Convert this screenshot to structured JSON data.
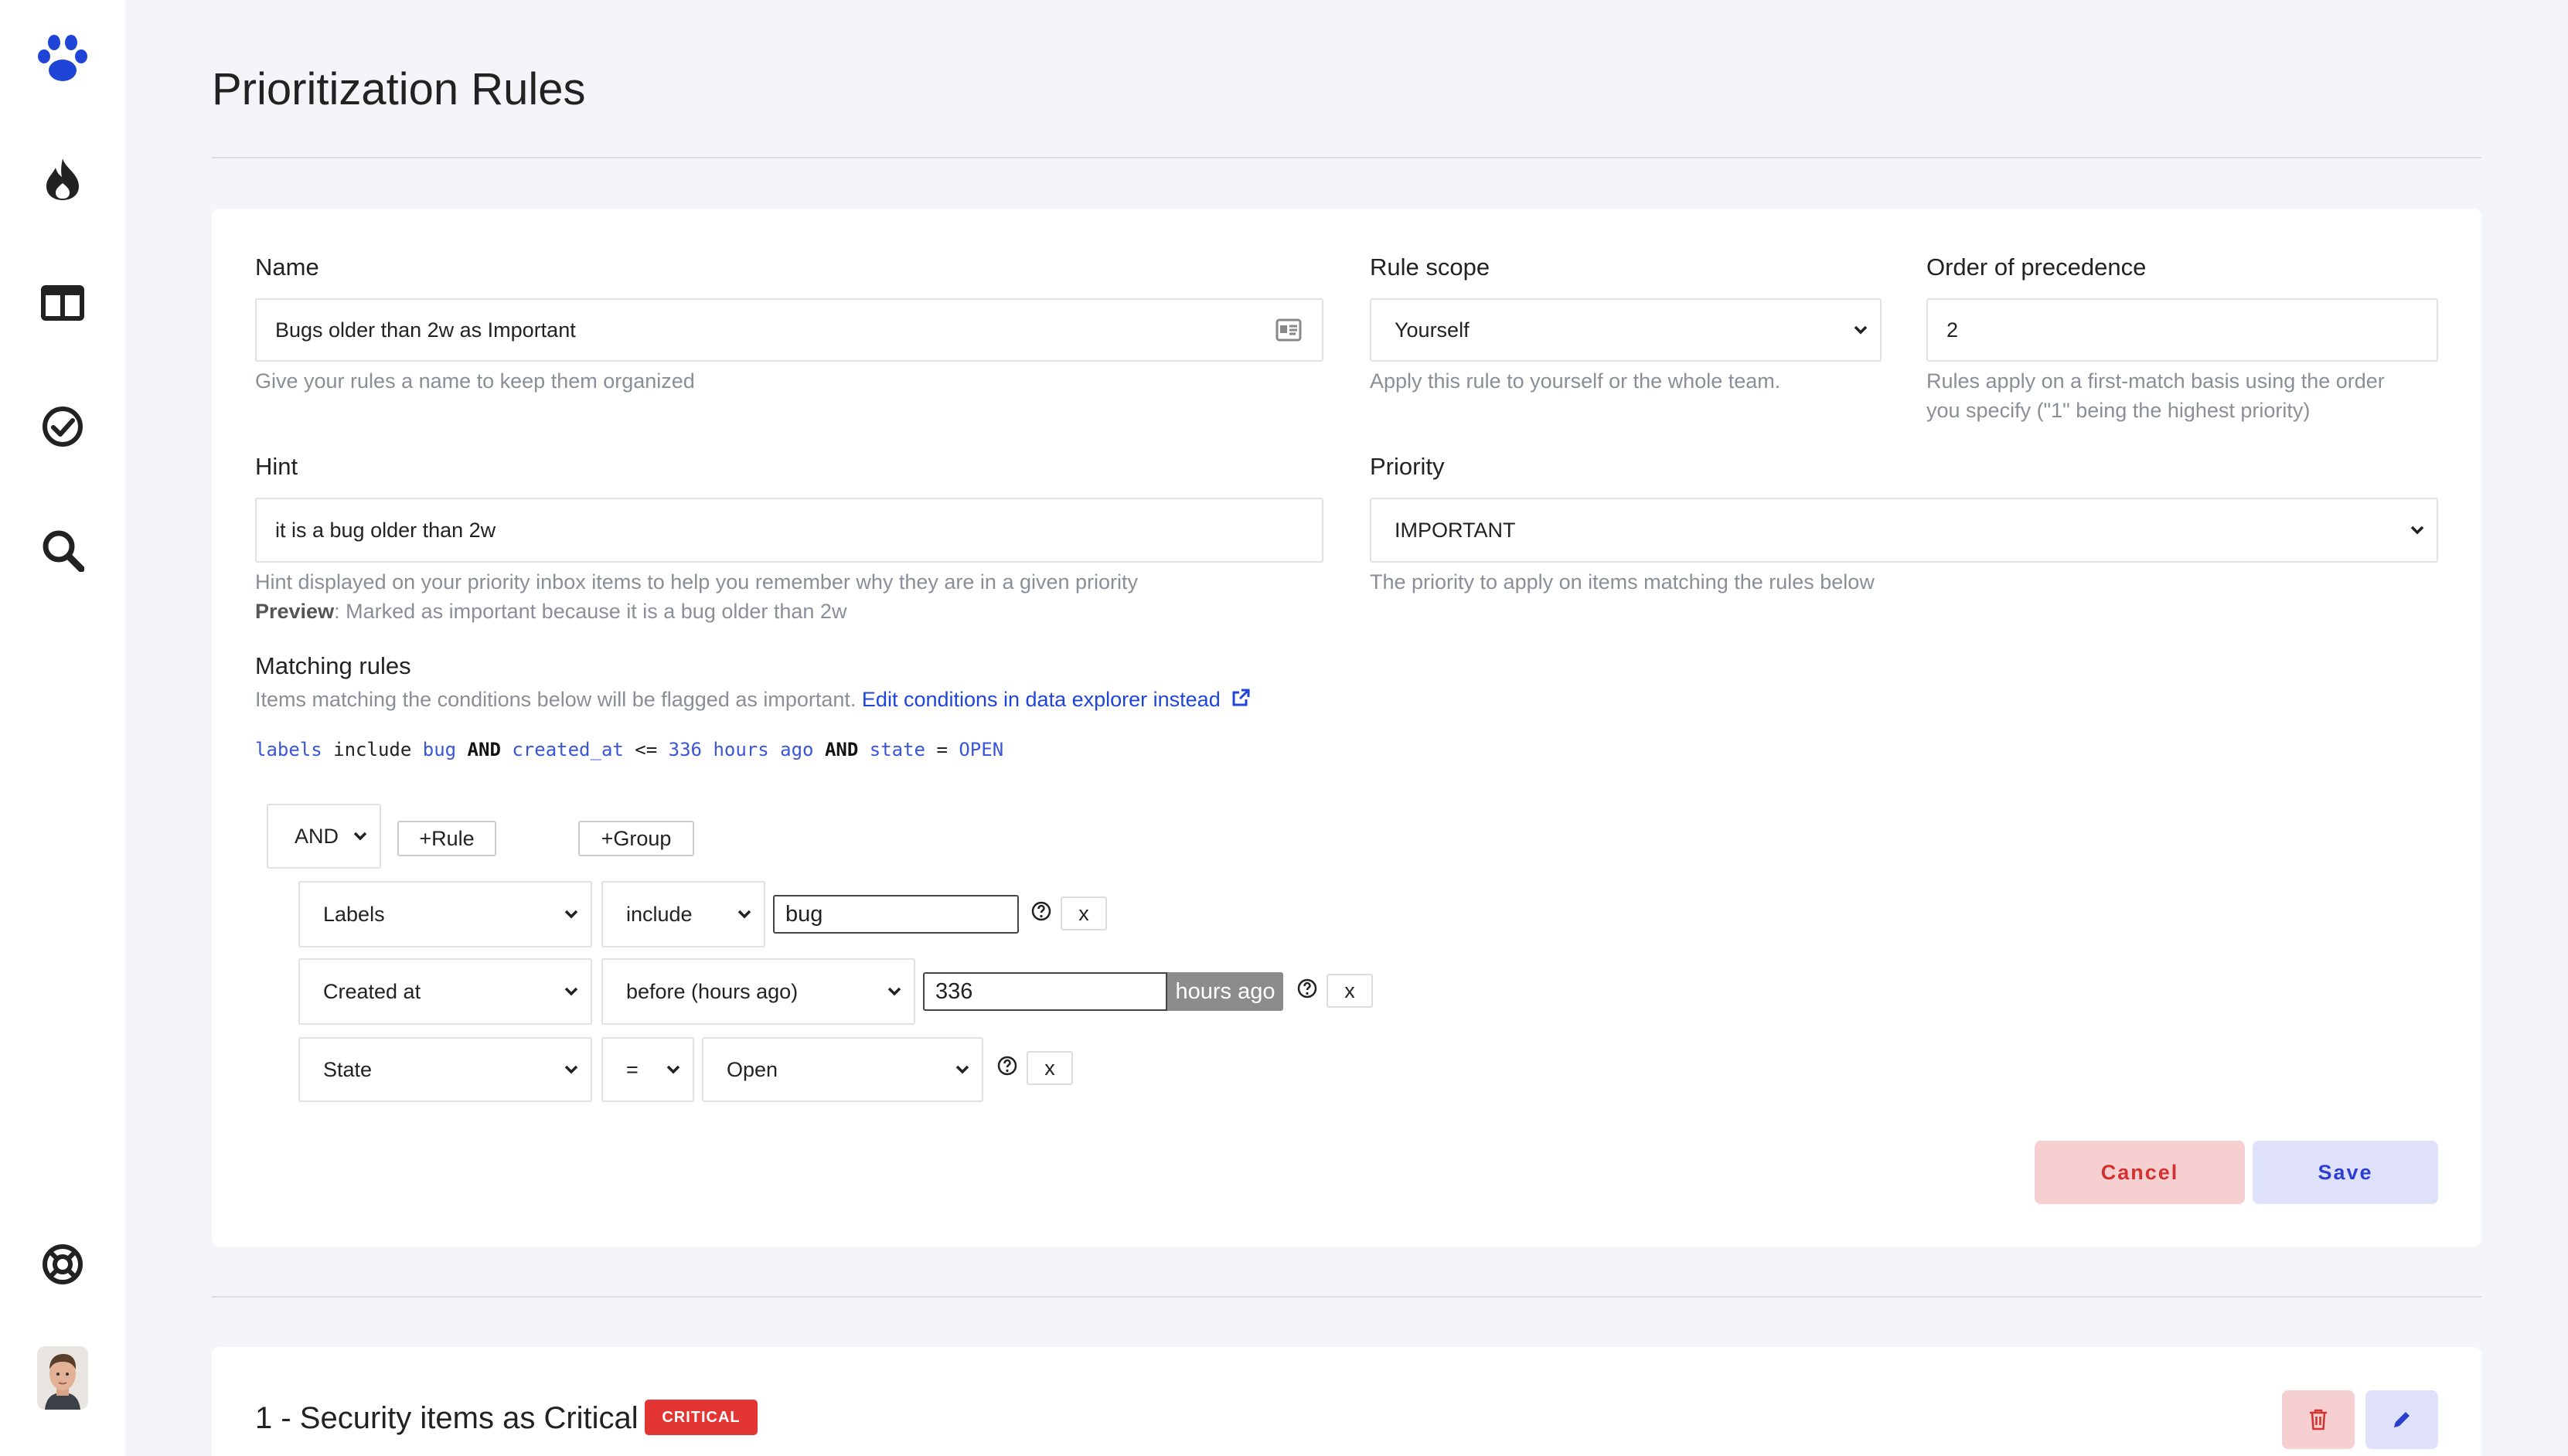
{
  "page": {
    "title": "Prioritization Rules"
  },
  "sidebar": {
    "items": [
      {
        "icon": "paw-icon"
      },
      {
        "icon": "fire-icon"
      },
      {
        "icon": "columns-icon"
      },
      {
        "icon": "check-circle-icon"
      },
      {
        "icon": "search-icon"
      },
      {
        "icon": "lifebuoy-icon"
      },
      {
        "icon": "avatar"
      }
    ]
  },
  "form": {
    "name": {
      "label": "Name",
      "value": "Bugs older than 2w as Important",
      "help": "Give your rules a name to keep them organized"
    },
    "scope": {
      "label": "Rule scope",
      "value": "Yourself",
      "help": "Apply this rule to yourself or the whole team."
    },
    "order": {
      "label": "Order of precedence",
      "value": "2",
      "help_line1": "Rules apply on a first-match basis using the order",
      "help_line2": "you specify (\"1\" being the highest priority)"
    },
    "hint": {
      "label": "Hint",
      "value": "it is a bug older than 2w",
      "help": "Hint displayed on your priority inbox items to help you remember why they are in a given priority",
      "preview_label": "Preview",
      "preview_text": ": Marked as important because it is a bug older than 2w"
    },
    "priority": {
      "label": "Priority",
      "value": "IMPORTANT",
      "help": "The priority to apply on items matching the rules below"
    },
    "matching": {
      "label": "Matching rules",
      "help": "Items matching the conditions below will be flagged as important. ",
      "link": "Edit conditions in data explorer instead",
      "query": {
        "t1": "labels",
        "t2": " include ",
        "t3": "bug",
        "t4": " AND ",
        "t5": "created_at",
        "t6": " <= ",
        "t7": "336 hours ago",
        "t8": " AND ",
        "t9": "state",
        "t10": " = ",
        "t11": "OPEN"
      }
    },
    "builder": {
      "combinator": "AND",
      "add_rule": "+Rule",
      "add_group": "+Group",
      "rules": [
        {
          "field": "Labels",
          "operator": "include",
          "value": "bug"
        },
        {
          "field": "Created at",
          "operator": "before (hours ago)",
          "value": "336",
          "addon": "hours ago"
        },
        {
          "field": "State",
          "operator": "=",
          "value": "Open"
        }
      ],
      "remove": "x"
    },
    "cancel": "Cancel",
    "save": "Save"
  },
  "list": {
    "items": [
      {
        "title": "1 - Security items as Critical",
        "badge": "CRITICAL"
      }
    ]
  },
  "colors": {
    "accent": "#1f45d8",
    "critical": "#e43535",
    "cancel_bg": "#f6d0d0",
    "save_bg": "#dfe1fb"
  }
}
